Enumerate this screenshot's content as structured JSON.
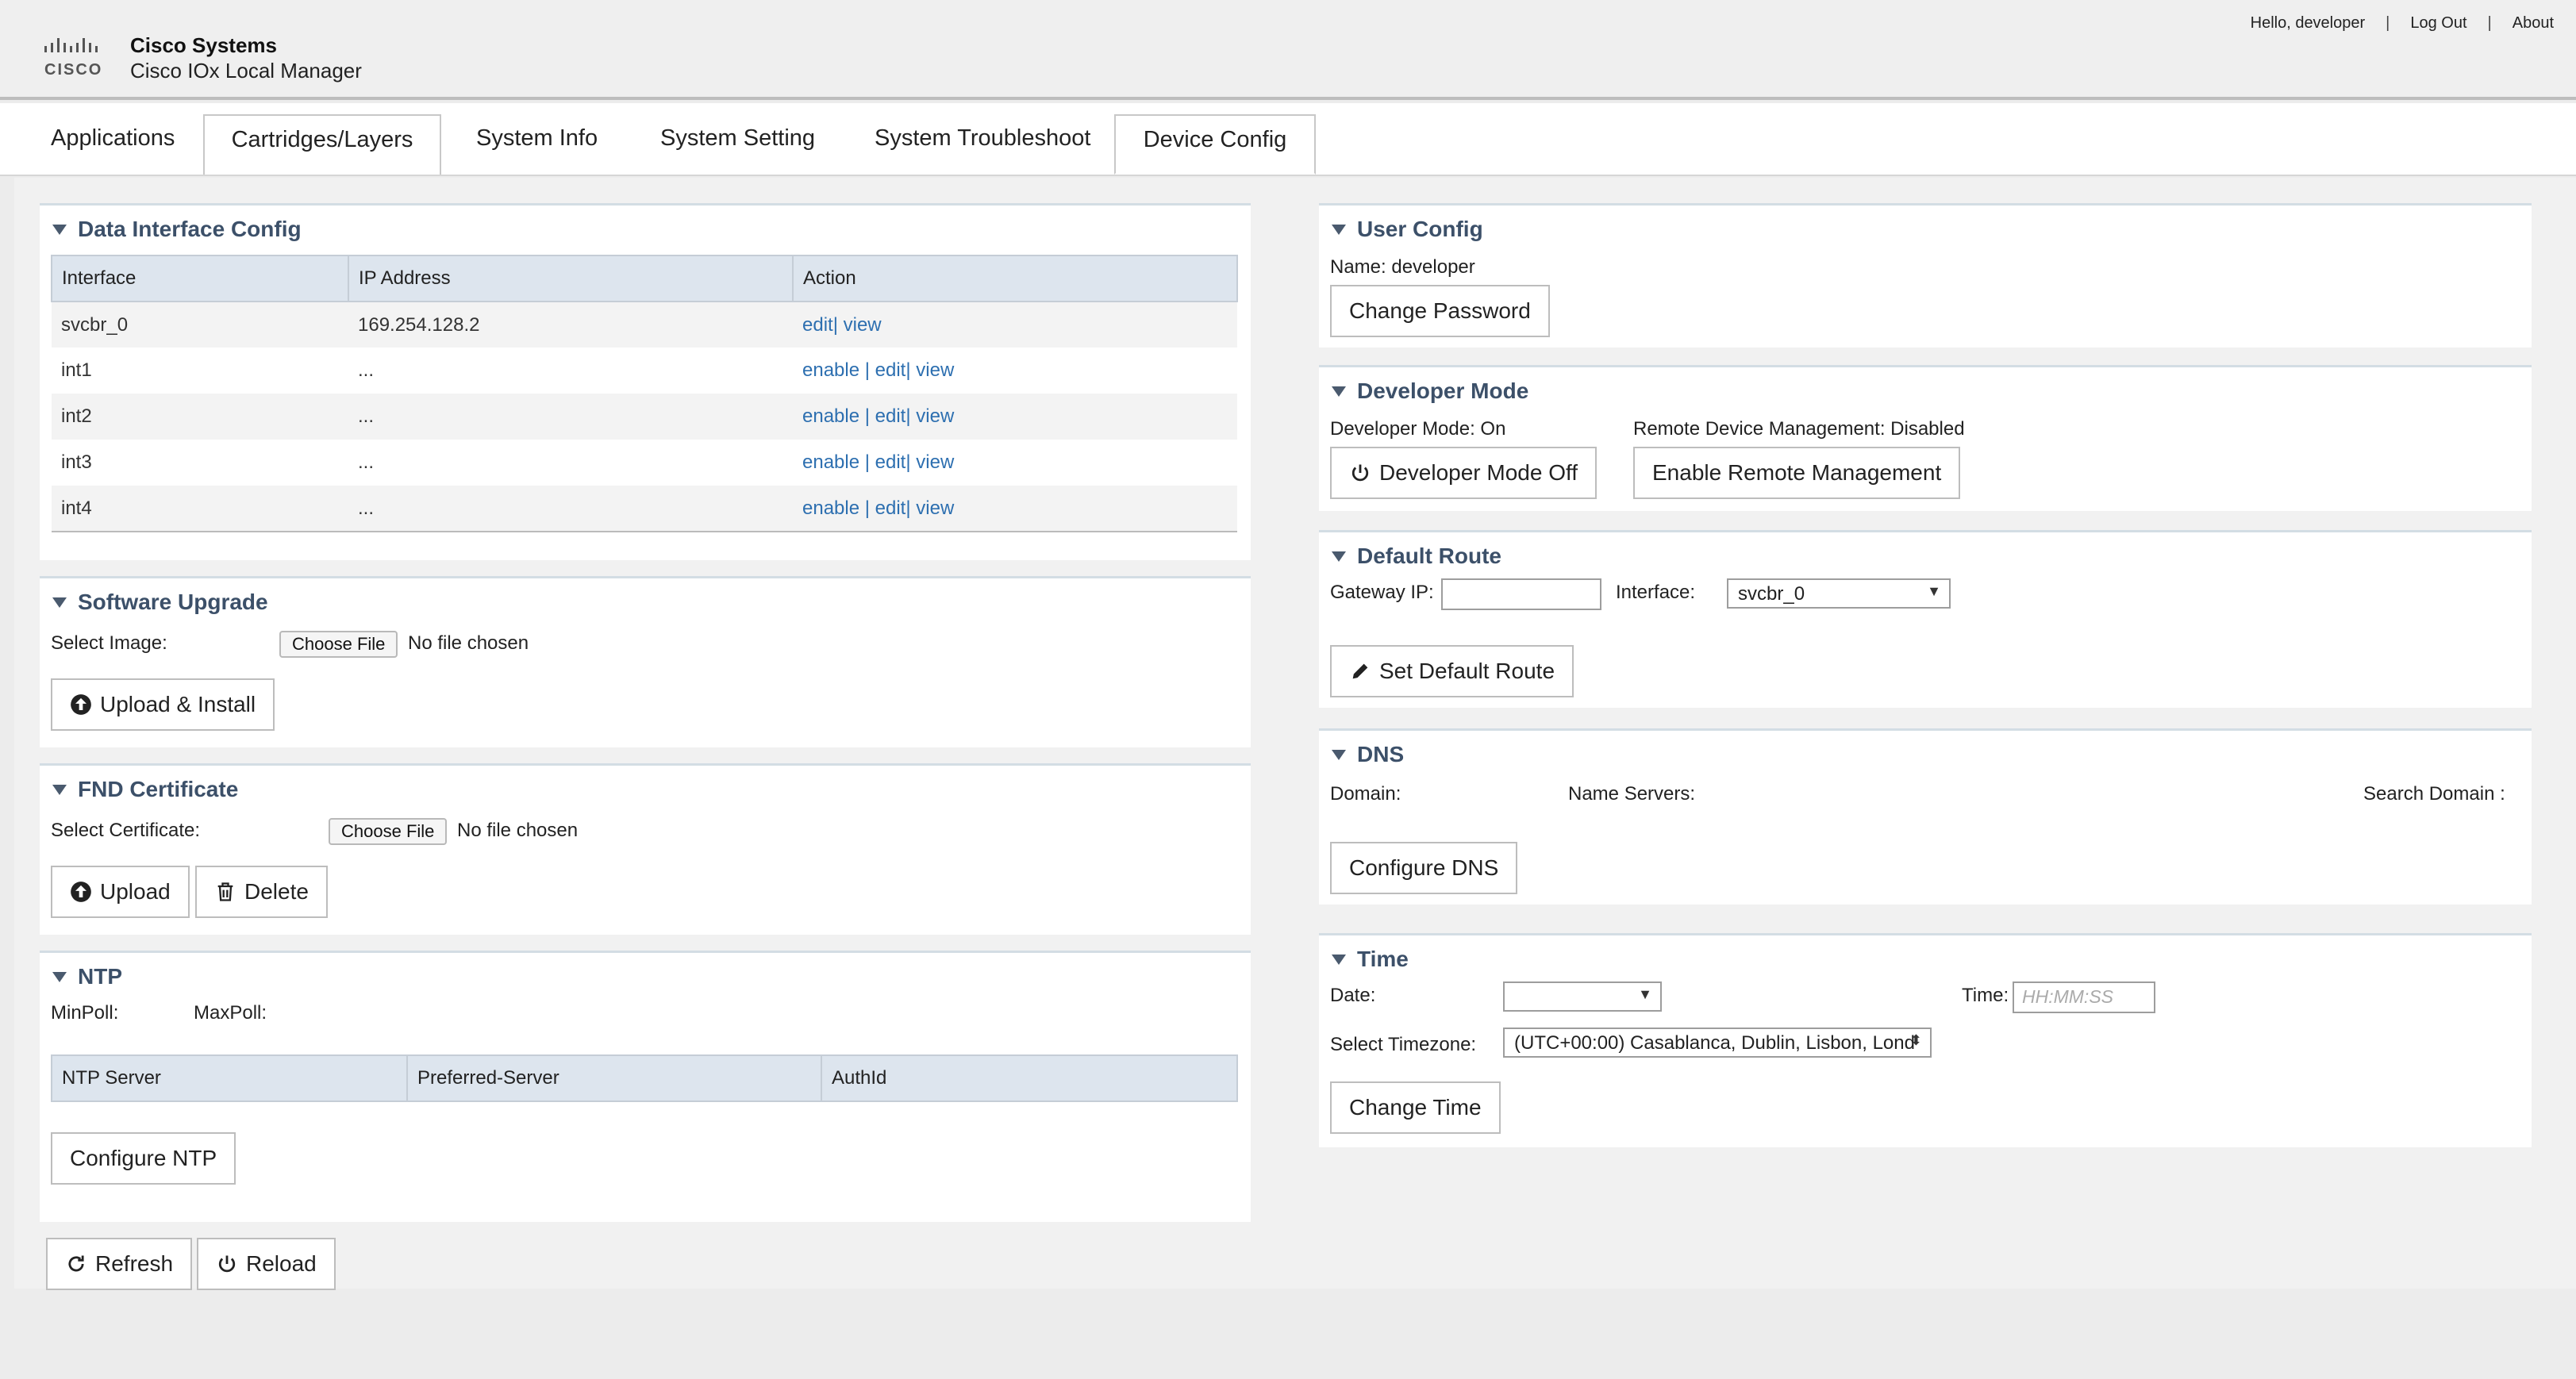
{
  "header": {
    "company": "Cisco Systems",
    "product": "Cisco IOx Local Manager",
    "greeting": "Hello, developer",
    "logout": "Log Out",
    "about": "About",
    "separator": "|"
  },
  "tabs": [
    {
      "label": "Applications"
    },
    {
      "label": "Cartridges/Layers"
    },
    {
      "label": "System Info"
    },
    {
      "label": "System Setting"
    },
    {
      "label": "System Troubleshoot"
    },
    {
      "label": "Device Config"
    }
  ],
  "data_interface": {
    "title": "Data Interface Config",
    "columns": [
      "Interface",
      "IP Address",
      "Action"
    ],
    "rows": [
      {
        "interface": "svcbr_0",
        "ip": "169.254.128.2",
        "enable": "",
        "edit": "edit|",
        "view": "view"
      },
      {
        "interface": "int1",
        "ip": "...",
        "enable": "enable |",
        "edit": "edit|",
        "view": "view"
      },
      {
        "interface": "int2",
        "ip": "...",
        "enable": "enable |",
        "edit": "edit|",
        "view": "view"
      },
      {
        "interface": "int3",
        "ip": "...",
        "enable": "enable |",
        "edit": "edit|",
        "view": "view"
      },
      {
        "interface": "int4",
        "ip": "...",
        "enable": "enable |",
        "edit": "edit|",
        "view": "view"
      }
    ]
  },
  "software_upgrade": {
    "title": "Software Upgrade",
    "select_label": "Select Image:",
    "choose_file": "Choose File",
    "no_file": "No file chosen",
    "upload_install": "Upload & Install"
  },
  "fnd_certificate": {
    "title": "FND Certificate",
    "select_label": "Select Certificate:",
    "choose_file": "Choose File",
    "no_file": "No file chosen",
    "upload": "Upload",
    "delete": "Delete"
  },
  "ntp": {
    "title": "NTP",
    "minpoll": "MinPoll:",
    "maxpoll": "MaxPoll:",
    "columns": [
      "NTP Server",
      "Preferred-Server",
      "AuthId"
    ],
    "configure": "Configure NTP"
  },
  "footer_buttons": {
    "refresh": "Refresh",
    "reload": "Reload"
  },
  "user_config": {
    "title": "User Config",
    "name": "Name: developer",
    "change_password": "Change Password"
  },
  "developer_mode": {
    "title": "Developer Mode",
    "status": "Developer Mode: On",
    "remote_status": "Remote Device Management: Disabled",
    "mode_off": "Developer Mode Off",
    "enable_remote": "Enable Remote Management"
  },
  "default_route": {
    "title": "Default Route",
    "gateway_label": "Gateway IP:",
    "gateway_value": "",
    "interface_label": "Interface:",
    "interface_value": "svcbr_0",
    "set_button": "Set Default Route"
  },
  "dns": {
    "title": "DNS",
    "domain": "Domain:",
    "name_servers": "Name Servers:",
    "search_domain": "Search Domain :",
    "configure": "Configure DNS"
  },
  "time": {
    "title": "Time",
    "date_label": "Date:",
    "date_value": "",
    "time_label": "Time:",
    "time_placeholder": "HH:MM:SS",
    "timezone_label": "Select Timezone:",
    "timezone_value": "(UTC+00:00) Casablanca, Dublin, Lisbon, Lond",
    "change": "Change Time"
  }
}
